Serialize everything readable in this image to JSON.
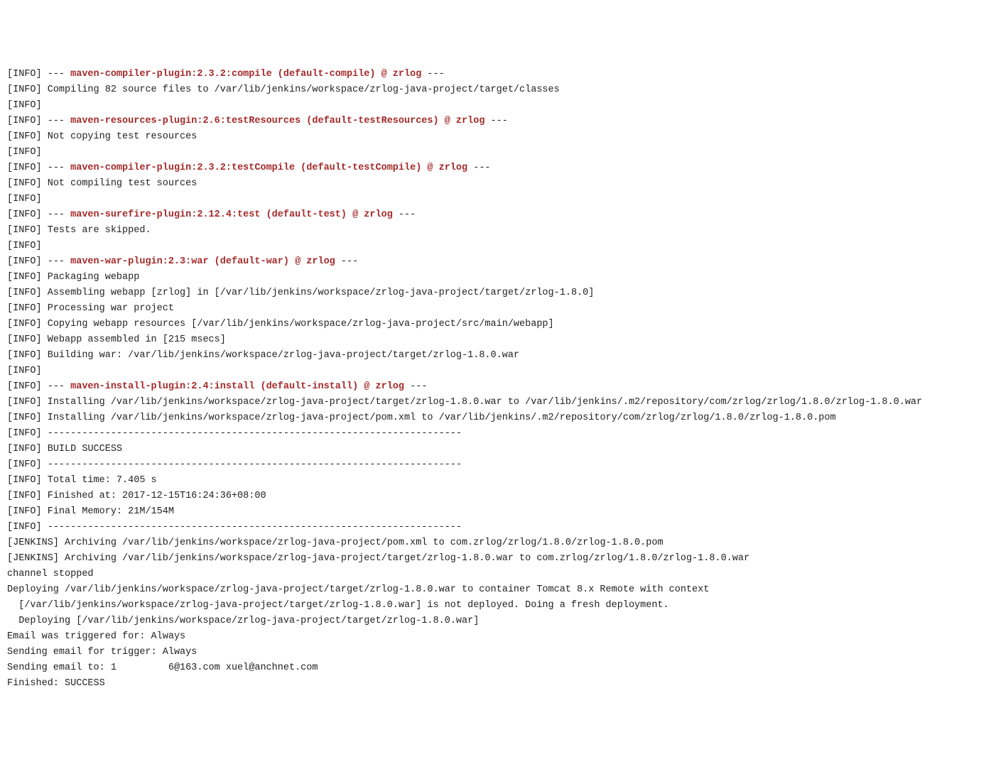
{
  "lines": [
    {
      "prefix": "[INFO] ",
      "marker": "--- ",
      "plugin": "maven-compiler-plugin:2.3.2:compile (default-compile) @ zrlog",
      "tail": " ---"
    },
    {
      "prefix": "[INFO] ",
      "text": "Compiling 82 source files to /var/lib/jenkins/workspace/zrlog-java-project/target/classes"
    },
    {
      "prefix": "[INFO]",
      "text": ""
    },
    {
      "prefix": "[INFO] ",
      "marker": "--- ",
      "plugin": "maven-resources-plugin:2.6:testResources (default-testResources) @ zrlog",
      "tail": " ---"
    },
    {
      "prefix": "[INFO] ",
      "text": "Not copying test resources"
    },
    {
      "prefix": "[INFO]",
      "text": ""
    },
    {
      "prefix": "[INFO] ",
      "marker": "--- ",
      "plugin": "maven-compiler-plugin:2.3.2:testCompile (default-testCompile) @ zrlog",
      "tail": " ---"
    },
    {
      "prefix": "[INFO] ",
      "text": "Not compiling test sources"
    },
    {
      "prefix": "[INFO]",
      "text": ""
    },
    {
      "prefix": "[INFO] ",
      "marker": "--- ",
      "plugin": "maven-surefire-plugin:2.12.4:test (default-test) @ zrlog",
      "tail": " ---"
    },
    {
      "prefix": "[INFO] ",
      "text": "Tests are skipped."
    },
    {
      "prefix": "[INFO]",
      "text": ""
    },
    {
      "prefix": "[INFO] ",
      "marker": "--- ",
      "plugin": "maven-war-plugin:2.3:war (default-war) @ zrlog",
      "tail": " ---"
    },
    {
      "prefix": "[INFO] ",
      "text": "Packaging webapp"
    },
    {
      "prefix": "[INFO] ",
      "text": "Assembling webapp [zrlog] in [/var/lib/jenkins/workspace/zrlog-java-project/target/zrlog-1.8.0]"
    },
    {
      "prefix": "[INFO] ",
      "text": "Processing war project"
    },
    {
      "prefix": "[INFO] ",
      "text": "Copying webapp resources [/var/lib/jenkins/workspace/zrlog-java-project/src/main/webapp]"
    },
    {
      "prefix": "[INFO] ",
      "text": "Webapp assembled in [215 msecs]"
    },
    {
      "prefix": "[INFO] ",
      "text": "Building war: /var/lib/jenkins/workspace/zrlog-java-project/target/zrlog-1.8.0.war"
    },
    {
      "prefix": "[INFO]",
      "text": ""
    },
    {
      "prefix": "[INFO] ",
      "marker": "--- ",
      "plugin": "maven-install-plugin:2.4:install (default-install) @ zrlog",
      "tail": " ---"
    },
    {
      "prefix": "[INFO] ",
      "text": "Installing /var/lib/jenkins/workspace/zrlog-java-project/target/zrlog-1.8.0.war to /var/lib/jenkins/.m2/repository/com/zrlog/zrlog/1.8.0/zrlog-1.8.0.war"
    },
    {
      "prefix": "[INFO] ",
      "text": "Installing /var/lib/jenkins/workspace/zrlog-java-project/pom.xml to /var/lib/jenkins/.m2/repository/com/zrlog/zrlog/1.8.0/zrlog-1.8.0.pom"
    },
    {
      "prefix": "[INFO] ",
      "text": "------------------------------------------------------------------------"
    },
    {
      "prefix": "[INFO] ",
      "text": "BUILD SUCCESS"
    },
    {
      "prefix": "[INFO] ",
      "text": "------------------------------------------------------------------------"
    },
    {
      "prefix": "[INFO] ",
      "text": "Total time: 7.405 s"
    },
    {
      "prefix": "[INFO] ",
      "text": "Finished at: 2017-12-15T16:24:36+08:00"
    },
    {
      "prefix": "[INFO] ",
      "text": "Final Memory: 21M/154M"
    },
    {
      "prefix": "[INFO] ",
      "text": "------------------------------------------------------------------------"
    },
    {
      "prefix": "[JENKINS] ",
      "text": "Archiving /var/lib/jenkins/workspace/zrlog-java-project/pom.xml to com.zrlog/zrlog/1.8.0/zrlog-1.8.0.pom"
    },
    {
      "prefix": "[JENKINS] ",
      "text": "Archiving /var/lib/jenkins/workspace/zrlog-java-project/target/zrlog-1.8.0.war to com.zrlog/zrlog/1.8.0/zrlog-1.8.0.war"
    },
    {
      "prefix": "",
      "text": "channel stopped"
    },
    {
      "prefix": "",
      "text": "Deploying /var/lib/jenkins/workspace/zrlog-java-project/target/zrlog-1.8.0.war to container Tomcat 8.x Remote with context"
    },
    {
      "prefix": "",
      "text": "  [/var/lib/jenkins/workspace/zrlog-java-project/target/zrlog-1.8.0.war] is not deployed. Doing a fresh deployment."
    },
    {
      "prefix": "",
      "text": "  Deploying [/var/lib/jenkins/workspace/zrlog-java-project/target/zrlog-1.8.0.war]"
    },
    {
      "prefix": "",
      "text": "Email was triggered for: Always"
    },
    {
      "prefix": "",
      "text": "Sending email for trigger: Always"
    },
    {
      "prefix": "",
      "text": "Sending email to: 1         6@163.com xuel@anchnet.com"
    },
    {
      "prefix": "",
      "text": "Finished: SUCCESS"
    }
  ]
}
